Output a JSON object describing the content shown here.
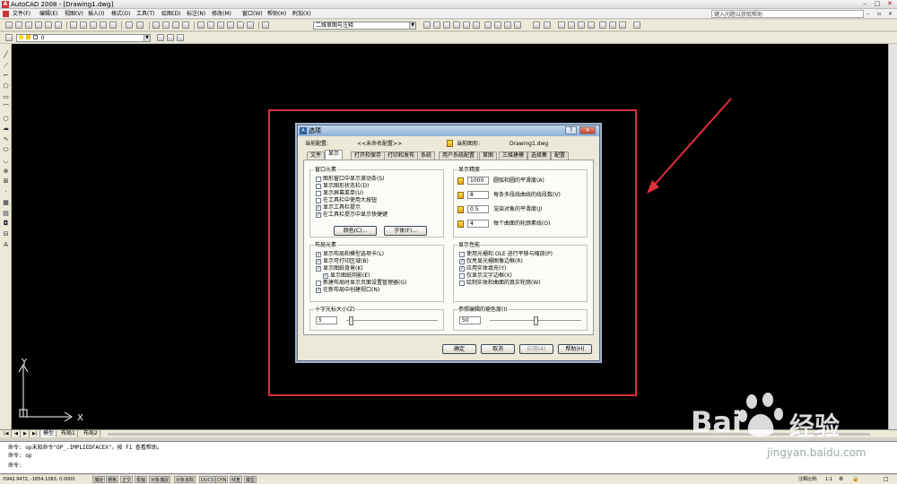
{
  "window": {
    "title": "AutoCAD 2008 - [Drawing1.dwg]",
    "icon_label": "A"
  },
  "menubar": {
    "items": [
      "文件(F)",
      "编辑(E)",
      "视图(V)",
      "插入(I)",
      "格式(O)",
      "工具(T)",
      "绘图(D)",
      "标注(N)",
      "修改(M)",
      "窗口(W)",
      "帮助(H)",
      "附加(X)"
    ],
    "help_search": "键入问题以获取帮助"
  },
  "toolbar": {
    "workspace_combo": "二维草图与注释",
    "layer_combo": "0"
  },
  "dialog": {
    "title": "选项",
    "current_profile_label": "当前配置:",
    "current_profile_value": "<<未命名配置>>",
    "current_drawing_label": "当前图形:",
    "current_drawing_value": "Drawing1.dwg",
    "tabs": [
      "文件",
      "显示",
      "打开和保存",
      "打印和发布",
      "系统",
      "用户系统配置",
      "草图",
      "三维建模",
      "选择集",
      "配置"
    ],
    "active_tab": "显示",
    "window_elements": {
      "title": "窗口元素",
      "items": [
        {
          "label": "图形窗口中显示滚动条(S)",
          "checked": false
        },
        {
          "label": "显示图形状态栏(D)",
          "checked": false
        },
        {
          "label": "显示屏幕菜单(U)",
          "checked": false
        },
        {
          "label": "在工具栏中使用大按钮",
          "checked": false
        },
        {
          "label": "显示工具栏提示",
          "checked": true
        },
        {
          "label": "在工具栏提示中显示快捷键",
          "checked": true
        }
      ],
      "colors_button": "颜色(C)...",
      "fonts_button": "字体(F)..."
    },
    "display_resolution": {
      "title": "显示精度",
      "items": [
        {
          "value": "1000",
          "label": "圆弧和圆的平滑度(A)"
        },
        {
          "value": "8",
          "label": "每条多段线曲线的线段数(V)"
        },
        {
          "value": "0.5",
          "label": "渲染对象的平滑度(J)"
        },
        {
          "value": "4",
          "label": "每个曲面的轮廓素线(O)"
        }
      ]
    },
    "layout_elements": {
      "title": "布局元素",
      "items": [
        {
          "label": "显示布局和模型选项卡(L)",
          "checked": true,
          "indent": false
        },
        {
          "label": "显示可打印区域(B)",
          "checked": true,
          "indent": false
        },
        {
          "label": "显示图纸背景(K)",
          "checked": true,
          "indent": false
        },
        {
          "label": "显示图纸阴影(E)",
          "checked": true,
          "indent": true
        },
        {
          "label": "新建布局时显示页面设置管理器(G)",
          "checked": false,
          "indent": false
        },
        {
          "label": "在新布局中创建视口(N)",
          "checked": true,
          "indent": false
        }
      ]
    },
    "display_performance": {
      "title": "显示性能",
      "items": [
        {
          "label": "使用光栅和 OLE 进行平移与缩放(P)",
          "checked": false
        },
        {
          "label": "仅亮显光栅图像边框(R)",
          "checked": true
        },
        {
          "label": "应用实体填充(Y)",
          "checked": true
        },
        {
          "label": "仅显示文字边框(X)",
          "checked": false
        },
        {
          "label": "绘制实体和曲面的真实轮廓(W)",
          "checked": false
        }
      ]
    },
    "crosshair_size": {
      "title": "十字光标大小(Z)",
      "value": "5",
      "fraction": 0.05
    },
    "fade_control": {
      "title": "参照编辑的褪色度(I)",
      "value": "50",
      "fraction": 0.5
    },
    "buttons": {
      "ok": "确定",
      "cancel": "取消",
      "apply": "应用(A)",
      "help": "帮助(H)"
    }
  },
  "layout_tabs": [
    "模型",
    "布局1",
    "布局2"
  ],
  "command_line": {
    "line1": "命令: op未知命令\"OP_.IMPLIEDFACEX\"。按 F1 查看帮助。",
    "line2": "命令: op",
    "line3": "命令:"
  },
  "statusbar": {
    "coords": "-5942.9472, -1854.1063, 0.0000",
    "toggles": [
      "捕捉",
      "栅格",
      "正交",
      "极轴",
      "对象捕捉",
      "对象追踪",
      "DUCS",
      "DYN",
      "线宽",
      "模型"
    ],
    "annotation_scale_label": "注释比例:",
    "annotation_scale_value": "1:1"
  },
  "watermark": {
    "brand": "Bai",
    "brand_suffix": "经验",
    "url": "jingyan.baidu.com"
  },
  "colors": {
    "highlight": "#d8303a",
    "canvas": "#000000"
  }
}
